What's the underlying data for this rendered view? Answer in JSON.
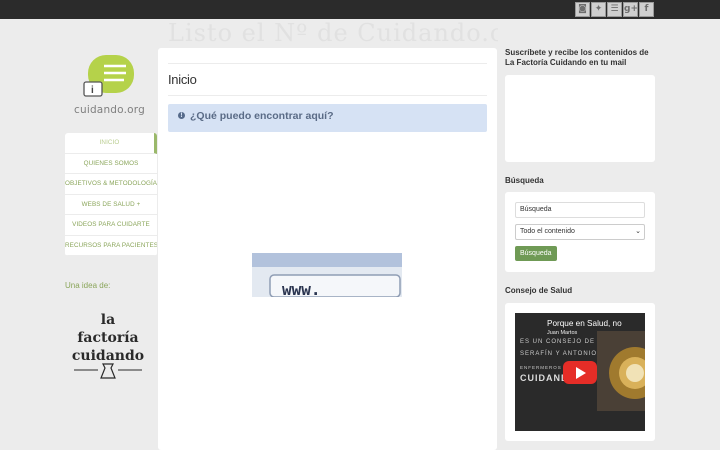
{
  "topbar": {
    "social": [
      {
        "icon": "instagram-icon",
        "glyph": "◙"
      },
      {
        "icon": "twitter-icon",
        "glyph": "✦"
      },
      {
        "icon": "rss-icon",
        "glyph": "☰"
      },
      {
        "icon": "google-plus-icon",
        "glyph": "g+"
      },
      {
        "icon": "facebook-icon",
        "glyph": "f"
      }
    ]
  },
  "header": {
    "background_text": "Listo el Nº de Cuidando.org",
    "logo_text": "cuidando.org"
  },
  "nav": {
    "items": [
      {
        "label": "INICIO",
        "active": true
      },
      {
        "label": "QUIENES SOMOS"
      },
      {
        "label": "OBJETIVOS & METODOLOGÍA"
      },
      {
        "label": "WEBS DE SALUD +"
      },
      {
        "label": "VIDEOS PARA CUIDARTE"
      },
      {
        "label": "RECURSOS PARA PACIENTES"
      }
    ]
  },
  "left": {
    "idea_label": "Una idea de:",
    "factoria_logo": {
      "line1": "la",
      "line2": "factoría",
      "line3": "cuidando"
    }
  },
  "main": {
    "title": "Inicio",
    "alert_text": "¿Qué puedo encontrar aquí?",
    "thumbnail_text": "www."
  },
  "sidebar": {
    "subscribe_title": "Suscríbete y recibe los contenidos de La Factoría Cuidando en tu mail",
    "search_title": "Búsqueda",
    "search_value": "Búsqueda",
    "select_value": "Todo el contenido",
    "search_button": "Búsqueda",
    "video_section_title": "Consejo de Salud",
    "video": {
      "title": "Porque en Salud, no",
      "author": "Juan Martos",
      "lines": [
        "ES UN CONSEJO DE",
        "SERAFÍN Y ANTONIO",
        "ENFERMEROS",
        "CUIDAND"
      ]
    }
  },
  "colors": {
    "accent_green": "#8aa55a",
    "button_green": "#6f9a55",
    "alert_blue": "#d6e2f4",
    "topbar": "#2b2b2b"
  }
}
